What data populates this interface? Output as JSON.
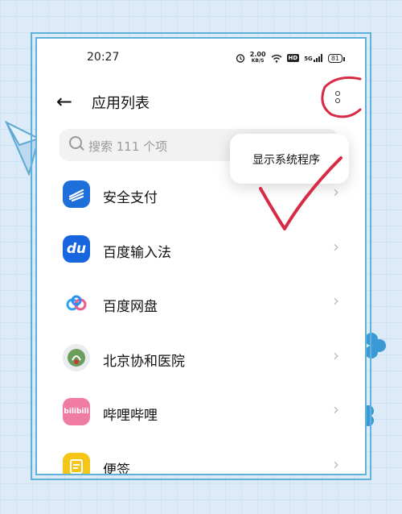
{
  "status_bar": {
    "time": "20:27",
    "net_speed_value": "2.00",
    "net_speed_unit": "KB/S",
    "hd_label": "HD",
    "signal_label": "5G",
    "battery": "81"
  },
  "header": {
    "back_icon": "arrow-left-icon",
    "title": "应用列表",
    "more_icon": "more-vertical-icon"
  },
  "search": {
    "placeholder": "搜索 111 个项"
  },
  "popup_menu": {
    "item": "显示系统程序"
  },
  "apps": [
    {
      "name": "安全支付",
      "icon": "alipay-security-icon",
      "color": "#1e6fd9"
    },
    {
      "name": "百度输入法",
      "icon": "baidu-input-icon",
      "color": "#1766e0"
    },
    {
      "name": "百度网盘",
      "icon": "baidu-netdisk-icon",
      "color": "#ffffff"
    },
    {
      "name": "北京协和医院",
      "icon": "pumch-hospital-icon",
      "color": "#e8ecef"
    },
    {
      "name": "哔哩哔哩",
      "icon": "bilibili-icon",
      "color": "#f07ca3"
    },
    {
      "name": "便签",
      "icon": "notes-icon",
      "color": "#f5c518"
    }
  ],
  "chevron_icon": "chevron-right-icon",
  "colors": {
    "frame": "#5fb2d9",
    "background": "#dcebf7",
    "annotation": "#d72b45"
  }
}
